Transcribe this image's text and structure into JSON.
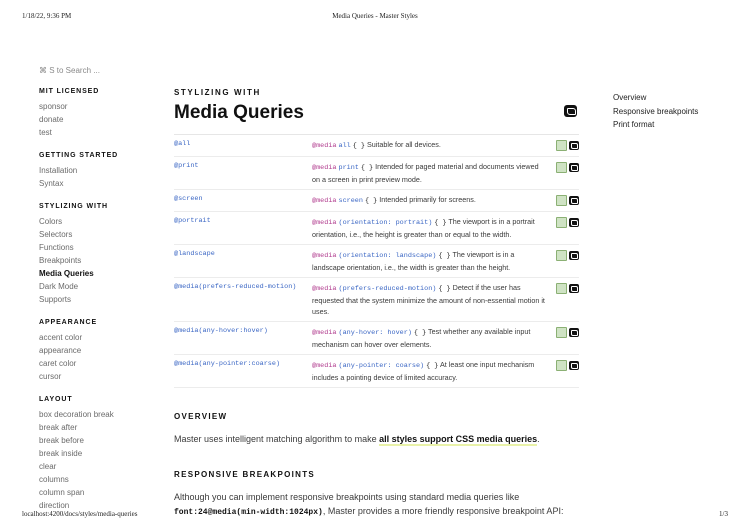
{
  "print": {
    "date": "1/18/22, 9:36 PM",
    "title": "Media Queries - Master Styles",
    "url": "localhost:4200/docs/styles/media-queries",
    "page": "1/3"
  },
  "sidebar": {
    "search": "⌘ S to Search ...",
    "sections": [
      {
        "heading": "MIT LICENSED",
        "items": [
          "sponsor",
          "donate",
          "test"
        ]
      },
      {
        "heading": "GETTING STARTED",
        "items": [
          "Installation",
          "Syntax"
        ]
      },
      {
        "heading": "STYLIZING WITH",
        "items": [
          "Colors",
          "Selectors",
          "Functions",
          "Breakpoints",
          "Media Queries",
          "Dark Mode",
          "Supports"
        ]
      },
      {
        "heading": "APPEARANCE",
        "items": [
          "accent color",
          "appearance",
          "caret color",
          "cursor"
        ]
      },
      {
        "heading": "LAYOUT",
        "items": [
          "box decoration break",
          "break after",
          "break before",
          "break inside",
          "clear",
          "columns",
          "column span",
          "direction"
        ]
      }
    ],
    "active": "Media Queries"
  },
  "main": {
    "kicker": "STYLIZING WITH",
    "title": "Media Queries",
    "rows": [
      {
        "sel": "@all",
        "kw": "@media",
        "v": "all",
        "b": "{ }",
        "desc": "Suitable for all devices."
      },
      {
        "sel": "@print",
        "kw": "@media",
        "v": "print",
        "b": "{ }",
        "desc": "Intended for paged material and documents viewed on a screen in print preview mode."
      },
      {
        "sel": "@screen",
        "kw": "@media",
        "v": "screen",
        "b": "{ }",
        "desc": "Intended primarily for screens."
      },
      {
        "sel": "@portrait",
        "kw": "@media",
        "v": "(orientation: portrait)",
        "b": "{ }",
        "desc": "The viewport is in a portrait orientation, i.e., the height is greater than or equal to the width."
      },
      {
        "sel": "@landscape",
        "kw": "@media",
        "v": "(orientation: landscape)",
        "b": "{ }",
        "desc": "The viewport is in a landscape orientation, i.e., the width is greater than the height."
      },
      {
        "sel": "@media(prefers-reduced-motion)",
        "kw": "@media",
        "v": "(prefers-reduced-motion)",
        "b": "{ }",
        "desc": "Detect if the user has requested that the system minimize the amount of non-essential motion it uses."
      },
      {
        "sel": "@media(any-hover:hover)",
        "kw": "@media",
        "v": "(any-hover: hover)",
        "b": "{ }",
        "desc": "Test whether any available input mechanism can hover over elements."
      },
      {
        "sel": "@media(any-pointer:coarse)",
        "kw": "@media",
        "v": "(any-pointer: coarse)",
        "b": "{ }",
        "desc": "At least one input mechanism includes a pointing device of limited accuracy."
      }
    ],
    "overview": {
      "heading": "OVERVIEW",
      "text_before": "Master uses intelligent matching algorithm to make ",
      "link": "all styles support CSS media queries",
      "text_after": "."
    },
    "breakpoints": {
      "heading": "RESPONSIVE BREAKPOINTS",
      "text1": "Although you can implement responsive breakpoints using standard media queries like",
      "code": "font:24@media(min-width:1024px)",
      "text2": ", Master provides a more friendly responsive breakpoint API:"
    }
  },
  "toc": {
    "items": [
      "Overview",
      "Responsive breakpoints",
      "Print format"
    ]
  }
}
